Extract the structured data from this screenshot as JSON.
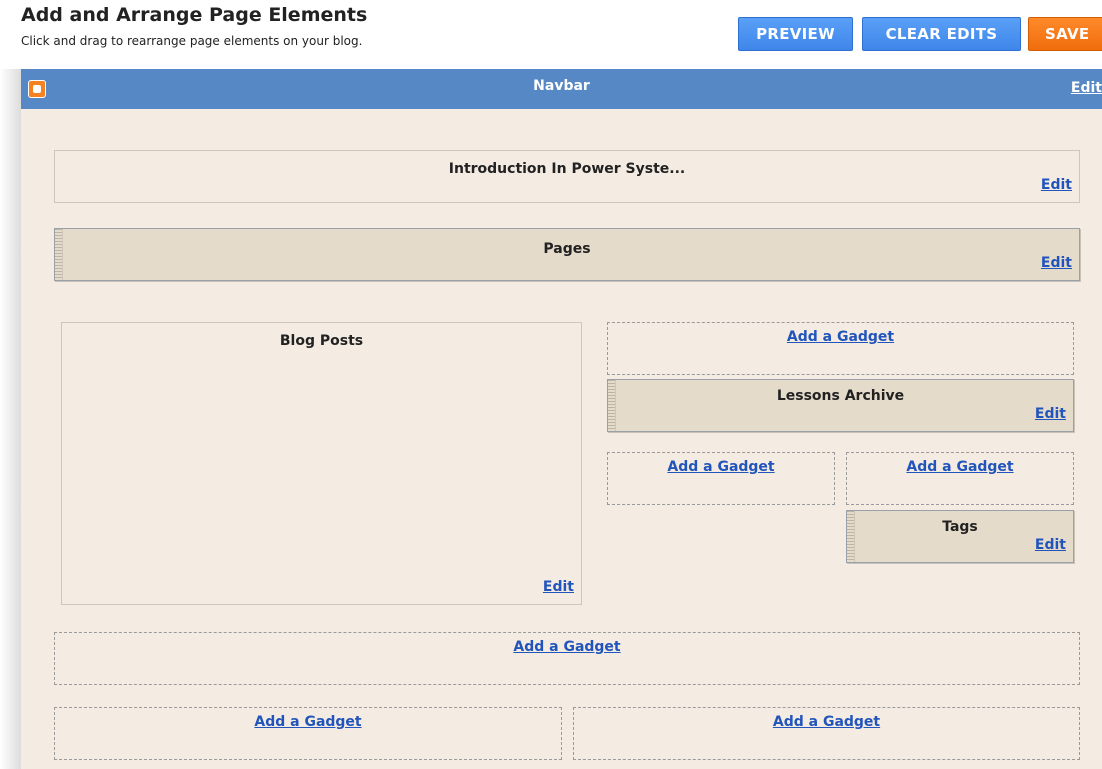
{
  "header": {
    "title": "Add and Arrange Page Elements",
    "subtitle": "Click and drag to rearrange page elements on your blog."
  },
  "toolbar": {
    "preview_label": "PREVIEW",
    "clear_edits_label": "CLEAR EDITS",
    "save_label": "SAVE"
  },
  "colors": {
    "navbar": "#5588c4",
    "layout_background": "#f4ece3",
    "locked_widget": "#e5dbcb",
    "button_blue": "#4a90f0",
    "button_orange": "#f57a1a",
    "link": "#2255bb"
  },
  "navbar": {
    "title": "Navbar",
    "edit_label": "Edit",
    "logo_icon": "blogger-logo-icon"
  },
  "widgets": {
    "header": {
      "title": "Introduction In Power Syste...",
      "edit_label": "Edit"
    },
    "pages": {
      "title": "Pages",
      "edit_label": "Edit"
    },
    "blog_posts": {
      "title": "Blog Posts",
      "edit_label": "Edit"
    },
    "lessons_archive": {
      "title": "Lessons Archive",
      "edit_label": "Edit"
    },
    "tags": {
      "title": "Tags",
      "edit_label": "Edit"
    }
  },
  "add_gadget_label": "Add a Gadget"
}
